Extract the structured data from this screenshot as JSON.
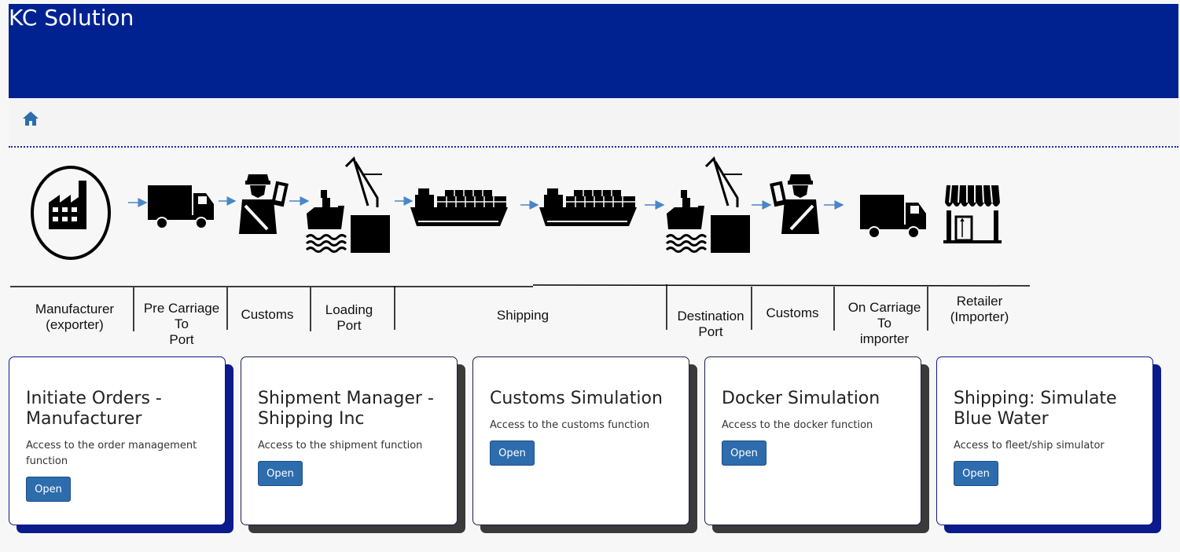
{
  "app": {
    "title": "KC Solution"
  },
  "nav": {
    "home_icon": "home-icon"
  },
  "flow": {
    "stages": [
      {
        "id": "manufacturer",
        "label": "Manufacturer\n(exporter)",
        "icon": "factory-icon"
      },
      {
        "id": "pre-carriage",
        "label": "Pre Carriage\nTo\nPort",
        "icon": "truck-icon"
      },
      {
        "id": "customs-origin",
        "label": "Customs",
        "icon": "customs-officer-icon"
      },
      {
        "id": "loading-port",
        "label": "Loading\nPort",
        "icon": "port-crane-icon"
      },
      {
        "id": "shipping",
        "label": "Shipping",
        "icon": "cargo-ship-icon"
      },
      {
        "id": "destination-port",
        "label": "Destination\nPort",
        "icon": "port-crane-icon"
      },
      {
        "id": "customs-destination",
        "label": "Customs",
        "icon": "customs-officer-icon"
      },
      {
        "id": "on-carriage",
        "label": "On Carriage\nTo\nimporter",
        "icon": "truck-icon"
      },
      {
        "id": "retailer",
        "label": "Retailer\n(Importer)",
        "icon": "storefront-icon"
      }
    ],
    "colors": {
      "arrow": "#4a86c8",
      "icon": "#000000"
    }
  },
  "cards": [
    {
      "title": "Initiate Orders - Manufacturer",
      "description": "Access to the order management function",
      "button": "Open"
    },
    {
      "title": "Shipment Manager - Shipping Inc",
      "description": "Access to the shipment function",
      "button": "Open"
    },
    {
      "title": "Customs Simulation",
      "description": "Access to the customs function",
      "button": "Open"
    },
    {
      "title": "Docker Simulation",
      "description": "Access to the docker function",
      "button": "Open"
    },
    {
      "title": "Shipping: Simulate Blue Water",
      "description": "Access to fleet/ship simulator",
      "button": "Open"
    }
  ],
  "theme": {
    "header_bg": "#002291",
    "button_bg": "#2d6cad",
    "card_shadow_blue": "#0b1b8c",
    "card_shadow_gray": "#3a3a3a"
  }
}
